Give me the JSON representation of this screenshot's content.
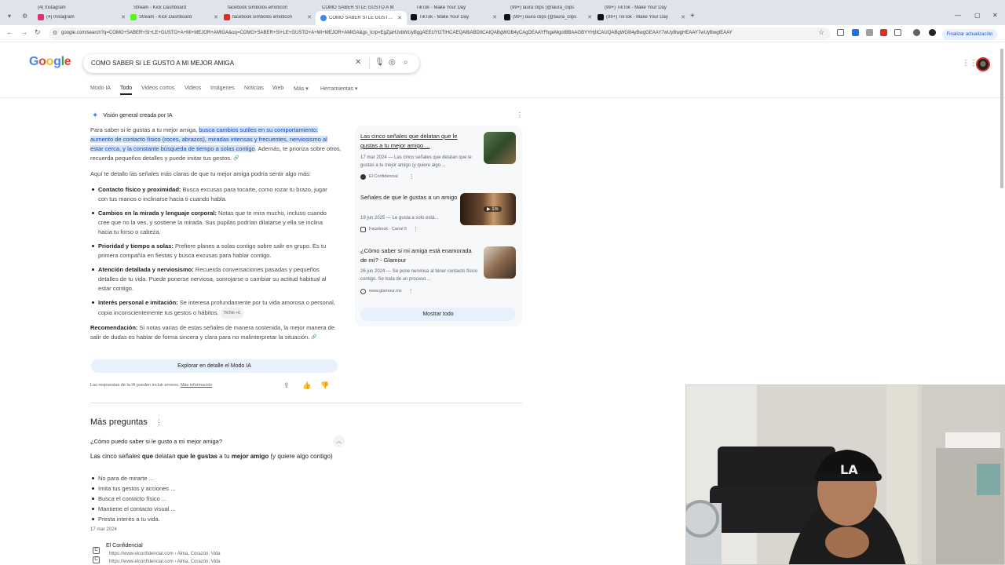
{
  "tabs": [
    {
      "label": "(4) Instagram",
      "color": "#e1306c"
    },
    {
      "label": "Stream - Kick Dashboard",
      "color": "#53fc18"
    },
    {
      "label": "facebook símbolos emoticon",
      "color": "#d93025"
    },
    {
      "label": "COMO SABER SI LE GUSTO A M",
      "color": "#4285f4",
      "active": true
    },
    {
      "label": "TikTok - Make Your Day",
      "color": "#111111"
    },
    {
      "label": "(99+) laura clips (@laura_clips",
      "color": "#111111"
    },
    {
      "label": "(99+) TikTok - Make Your Day",
      "color": "#111111"
    }
  ],
  "tabs_row1": [
    "(4) Instagram",
    "Stream - Kick Dashboard",
    "facebook símbolos emoticon",
    "COMO SABER SI LE GUSTO A M",
    "TikTok - Make Your Day",
    "(99+) laura clips (@laura_clips",
    "(99+) TikTok - Make Your Day"
  ],
  "address_bar": {
    "url": "google.com/search?q=COMO+SABER+SI+LE+GUSTO+A+MI+MEJOR+AMIGA&oq=COMO+SABER+SI+LE+GUSTO+A+MI+MEJOR+AMIGA&gs_lcrp=EgZjaHJvbWUyBggAEEUYOTIHCAEQABiABDIICAIQABgWGB4yCAgDEAAYFhgeMgoIBBAAGBYYHjIICAUQABgWGB4yBwgGEAAY7wUyBwgHEAAY7wUyBwgIEAAY",
    "update_label": "Finalizar actualización"
  },
  "google": {
    "logo": "Google",
    "query": "COMO SABER SI LE GUSTO A MI MEJOR AMIGA"
  },
  "filters": [
    "Modo IA",
    "Todo",
    "Videos cortos",
    "Videos",
    "Imágenes",
    "Noticias",
    "Web",
    "Más",
    "Herramientas"
  ],
  "ai_overview": {
    "title": "Visión general creada por IA",
    "intro_plain": "Para saber si le gustas a tu mejor amiga, ",
    "intro_highlight": "busca cambios sutiles en su comportamiento: aumento de contacto físico (roces, abrazos), miradas intensas y frecuentes, nerviosismo al estar cerca, y la constante búsqueda de tiempo a solas contigo",
    "intro_tail": ". Además, te prioriza sobre otros, recuerda pequeños detalles y puede imitar tus gestos.",
    "lead": "Aquí te detallo las señales más claras de que tu mejor amiga podría sentir algo más:",
    "bullets": [
      {
        "head": "Contacto físico y proximidad:",
        "text": " Busca excusas para tocarte, como rozar tu brazo, jugar con tus manos o inclinarse hacia ti cuando habla."
      },
      {
        "head": "Cambios en la mirada y lenguaje corporal:",
        "text": " Notas que te mira mucho, incluso cuando cree que no la ves, y sostiene la mirada. Sus pupilas podrían dilatarse y ella se inclina hacia tu forso o cabeza."
      },
      {
        "head": "Prioridad y tiempo a solas:",
        "text": " Prefiere planes a solas contigo sobre salir en grupo. Es tu primera compañía en fiestas y busca excusas para hablar contigo."
      },
      {
        "head": "Atención detallada y nerviosismo:",
        "text": " Recuerda conversaciones pasadas y pequeños detalles de tu vida. Puede ponerse nerviosa, sonrojarse o cambiar su actitud habitual al estar contigo."
      },
      {
        "head": "Interés personal e imitación:",
        "text": " Se interesa profundamente por tu vida amorosa o personal, copia inconscientemente tus gestos o hábitos."
      }
    ],
    "bullet5_chip": "TikTok +6",
    "recommendation_head": "Recomendación:",
    "recommendation_text": " Si notas varias de estas señales de manera sostenida, la mejor manera de salir de dudas es hablar de forma sincera y clara para no malinterpretar la situación.",
    "explore_button": "Explorar en detalle el Modo IA",
    "footer_text": "Las respuestas de la IA pueden incluir errores. ",
    "footer_link": "Más información"
  },
  "sources": [
    {
      "title": "Las cinco señales que delatan que le gustas a tu mejor amigo ...",
      "snippet": "17 mar 2024 — Las cinco señales que delatan que le gustas a tu mejor amigo (y quiere algo ...",
      "site": "El Confidencial"
    },
    {
      "title": "Señales de que le gustas a un amigo",
      "snippet": "19 jun 2025 — Le gusta a solo está...",
      "site": "Facebook · Canal 5",
      "duration": "1m"
    },
    {
      "title": "¿Cómo saber si mi amiga está enamorada de mí? - Glamour",
      "snippet": "26 jun 2024 — Se pone nerviosa al tener contacto físico contigo. Se trata de un proceso ...",
      "site": "www.glamour.mx"
    }
  ],
  "show_all": "Mostrar todo",
  "paa": {
    "title": "Más preguntas",
    "question": "¿Cómo puedo saber si le gusto a mi mejor amiga?",
    "answer_parts": [
      "Las cinco señales ",
      "que",
      " delatan ",
      "que le gustas",
      " a tu ",
      "mejor amigo",
      " (y quiere algo contigo)"
    ],
    "items": [
      "No para de mirarte ...",
      "Imita tus gestos y acciones ...",
      "Busca el contacto físico ...",
      "Mantiene el contacto visual ...",
      "Presta interés a tu vida."
    ],
    "date": "17 mar 2024",
    "site": "El Confidencial",
    "url": "https://www.elconfidencial.com › Alma, Corazón, Vida",
    "url2": "https://www.elconfidencial.com › Alma, Corazón, Vida"
  },
  "webcam": {
    "cap_text": "LA"
  }
}
